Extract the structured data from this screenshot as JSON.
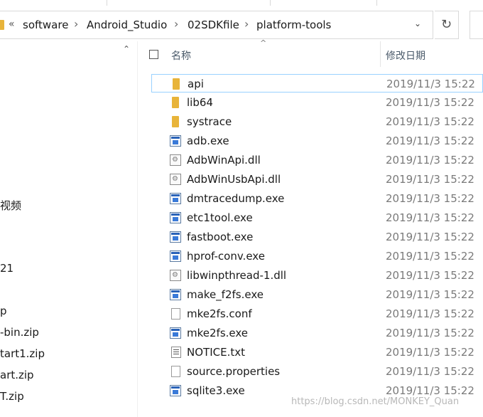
{
  "breadcrumb": {
    "overflow": "«",
    "items": [
      "software",
      "Android_Studio",
      "02SDKfile",
      "platform-tools"
    ],
    "separator": "›",
    "dropdown": "⌄",
    "refresh": "↻"
  },
  "nav": {
    "items": [
      "视频",
      "21",
      "p",
      "-bin.zip",
      "tart1.zip",
      "art.zip",
      "T.zip"
    ]
  },
  "columns": {
    "name": "名称",
    "date_modified": "修改日期",
    "sort_indicator": "^"
  },
  "files": [
    {
      "name": "api",
      "type": "folder",
      "date": "2019/11/3 15:22",
      "selected": true
    },
    {
      "name": "lib64",
      "type": "folder",
      "date": "2019/11/3 15:22"
    },
    {
      "name": "systrace",
      "type": "folder",
      "date": "2019/11/3 15:22"
    },
    {
      "name": "adb.exe",
      "type": "exe",
      "date": "2019/11/3 15:22"
    },
    {
      "name": "AdbWinApi.dll",
      "type": "dll",
      "date": "2019/11/3 15:22"
    },
    {
      "name": "AdbWinUsbApi.dll",
      "type": "dll",
      "date": "2019/11/3 15:22"
    },
    {
      "name": "dmtracedump.exe",
      "type": "exe",
      "date": "2019/11/3 15:22"
    },
    {
      "name": "etc1tool.exe",
      "type": "exe",
      "date": "2019/11/3 15:22"
    },
    {
      "name": "fastboot.exe",
      "type": "exe",
      "date": "2019/11/3 15:22"
    },
    {
      "name": "hprof-conv.exe",
      "type": "exe",
      "date": "2019/11/3 15:22"
    },
    {
      "name": "libwinpthread-1.dll",
      "type": "dll",
      "date": "2019/11/3 15:22"
    },
    {
      "name": "make_f2fs.exe",
      "type": "exe",
      "date": "2019/11/3 15:22"
    },
    {
      "name": "mke2fs.conf",
      "type": "file",
      "date": "2019/11/3 15:22"
    },
    {
      "name": "mke2fs.exe",
      "type": "exe",
      "date": "2019/11/3 15:22"
    },
    {
      "name": "NOTICE.txt",
      "type": "txt",
      "date": "2019/11/3 15:22"
    },
    {
      "name": "source.properties",
      "type": "file",
      "date": "2019/11/3 15:22"
    },
    {
      "name": "sqlite3.exe",
      "type": "exe",
      "date": "2019/11/3 15:22"
    }
  ],
  "watermark": "https://blog.csdn.net/MONKEY_Quan",
  "colors": {
    "selection_border": "#99d1ff",
    "folder": "#e8b43a",
    "date_text": "#7a7a7a"
  }
}
